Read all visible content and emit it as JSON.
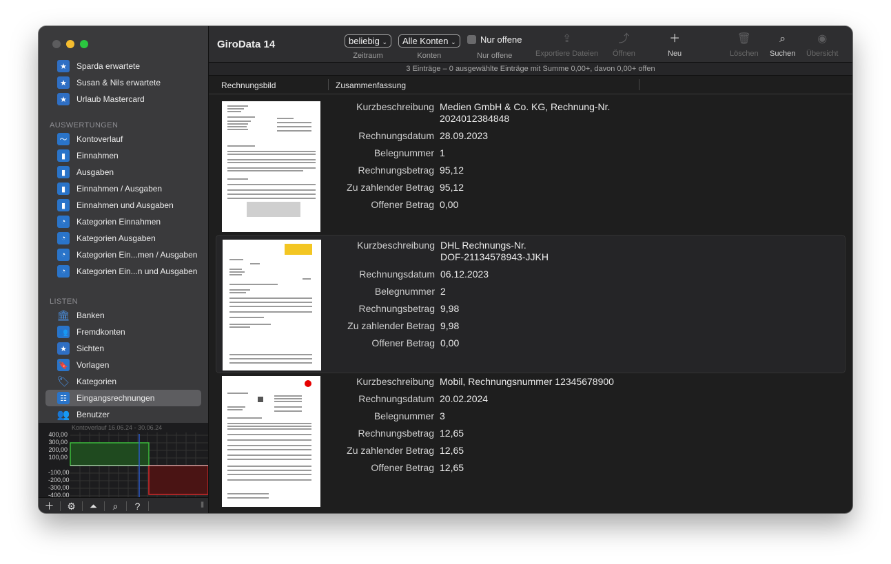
{
  "app": {
    "title": "GiroData 14"
  },
  "sidebar": {
    "top_items": [
      {
        "label": "Sparda erwartete",
        "icon": "star-icon"
      },
      {
        "label": "Susan & Nils erwartete",
        "icon": "star-icon"
      },
      {
        "label": "Urlaub Mastercard",
        "icon": "star-icon"
      }
    ],
    "section_auswertungen": "AUSWERTUNGEN",
    "auswertungen": [
      {
        "label": "Kontoverlauf",
        "icon": "line-chart-icon"
      },
      {
        "label": "Einnahmen",
        "icon": "bar-chart-icon"
      },
      {
        "label": "Ausgaben",
        "icon": "bar-chart-icon"
      },
      {
        "label": "Einnahmen / Ausgaben",
        "icon": "bar-chart-icon"
      },
      {
        "label": "Einnahmen und Ausgaben",
        "icon": "bar-chart-icon"
      },
      {
        "label": "Kategorien Einnahmen",
        "icon": "pie-chart-icon"
      },
      {
        "label": "Kategorien Ausgaben",
        "icon": "pie-chart-icon"
      },
      {
        "label": "Kategorien Ein...men / Ausgaben",
        "icon": "pie-chart-icon"
      },
      {
        "label": "Kategorien Ein...n und Ausgaben",
        "icon": "pie-chart-icon"
      }
    ],
    "section_listen": "LISTEN",
    "listen": [
      {
        "label": "Banken",
        "icon": "bank-icon"
      },
      {
        "label": "Fremdkonten",
        "icon": "people-icon"
      },
      {
        "label": "Sichten",
        "icon": "star-icon"
      },
      {
        "label": "Vorlagen",
        "icon": "bookmark-icon"
      },
      {
        "label": "Kategorien",
        "icon": "tag-icon"
      },
      {
        "label": "Eingangsrechnungen",
        "icon": "invoice-icon",
        "selected": true
      },
      {
        "label": "Benutzer",
        "icon": "users-icon"
      }
    ]
  },
  "mini_chart": {
    "title": "Kontoverlauf 16.06.24 - 30.06.24",
    "y_labels": [
      "400,00",
      "300,00",
      "200,00",
      "100,00",
      "-100,00",
      "-200,00",
      "-300,00",
      "-400,00"
    ],
    "positive_color": "#2d8a2d",
    "negative_color": "#b02020"
  },
  "toolbar": {
    "zeitraum_value": "beliebig",
    "zeitraum_label": "Zeitraum",
    "konten_value": "Alle Konten",
    "konten_label": "Konten",
    "nur_offene_check": "Nur offene",
    "nur_offene_label": "Nur offene",
    "exportieren_label": "Exportiere Dateien",
    "oeffnen_label": "Öffnen",
    "neu_label": "Neu",
    "loeschen_label": "Löschen",
    "suchen_label": "Suchen",
    "uebersicht_label": "Übersicht"
  },
  "status": "3 Einträge – 0 ausgewählte Einträge mit Summe 0,00+, davon 0,00+ offen",
  "columns": {
    "bild": "Rechnungsbild",
    "zusammenfassung": "Zusammenfassung"
  },
  "field_labels": {
    "kurz": "Kurzbeschreibung",
    "datum": "Rechnungsdatum",
    "beleg": "Belegnummer",
    "betrag": "Rechnungsbetrag",
    "zahlend": "Zu zahlender Betrag",
    "offen": "Offener Betrag"
  },
  "invoices": [
    {
      "kurz_line1": "Medien GmbH & Co. KG, Rechnung-Nr.",
      "kurz_line2": "2024012384848",
      "datum": "28.09.2023",
      "beleg": "1",
      "betrag": "95,12",
      "zahlend": "95,12",
      "offen": "0,00"
    },
    {
      "kurz_line1": "DHL Rechnungs-Nr.",
      "kurz_line2": "DOF-21134578943-JJKH",
      "datum": "06.12.2023",
      "beleg": "2",
      "betrag": "9,98",
      "zahlend": "9,98",
      "offen": "0,00"
    },
    {
      "kurz_line1": "Mobil, Rechnungsnummer 12345678900",
      "kurz_line2": "",
      "datum": "20.02.2024",
      "beleg": "3",
      "betrag": "12,65",
      "zahlend": "12,65",
      "offen": "12,65"
    }
  ]
}
